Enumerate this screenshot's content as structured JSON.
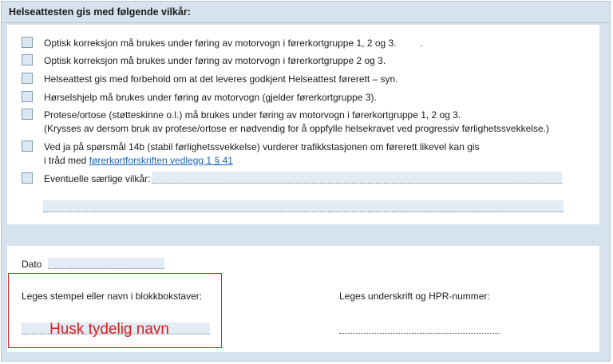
{
  "header": {
    "title": "Helseattesten gis med følgende vilkår:"
  },
  "conditions": [
    {
      "line1": "Optisk korreksjon må brukes under føring av motorvogn i førerkortgruppe 1, 2 og 3.",
      "mark": "."
    },
    {
      "line1": "Optisk korreksjon må brukes under føring av motorvogn i førerkortgruppe 2 og 3."
    },
    {
      "line1": "Helseattest gis med forbehold om at det leveres godkjent Helseattest førerett – syn."
    },
    {
      "line1": "Hørselshjelp må brukes under føring av motorvogn (gjelder førerkortgruppe 3)."
    },
    {
      "line1": "Protese/ortose (støtteskinne o.l.) må brukes under føring av motorvogn i førerkortgruppe 1, 2 og 3.",
      "line2": "(Krysses av dersom bruk av protese/ortose er nødvendig for å oppfylle helsekravet ved progressiv førlighetssvekkelse.)"
    },
    {
      "line1": "Ved ja på spørsmål 14b (stabil førlighetssvekkelse) vurderer trafikkstasjonen om førerett likevel kan gis",
      "line2_prefix": "i tråd med ",
      "line2_link": "førerkortforskriften vedlegg 1 § 41"
    },
    {
      "line1": "Eventuelle særlige vilkår:"
    }
  ],
  "bottom": {
    "date_label": "Dato",
    "stamp_label": "Leges stempel eller navn i blokkbokstaver:",
    "signature_label": "Leges underskrift og HPR-nummer:",
    "annotation": "Husk tydelig navn",
    "annotation_color": "#e21b1b"
  }
}
